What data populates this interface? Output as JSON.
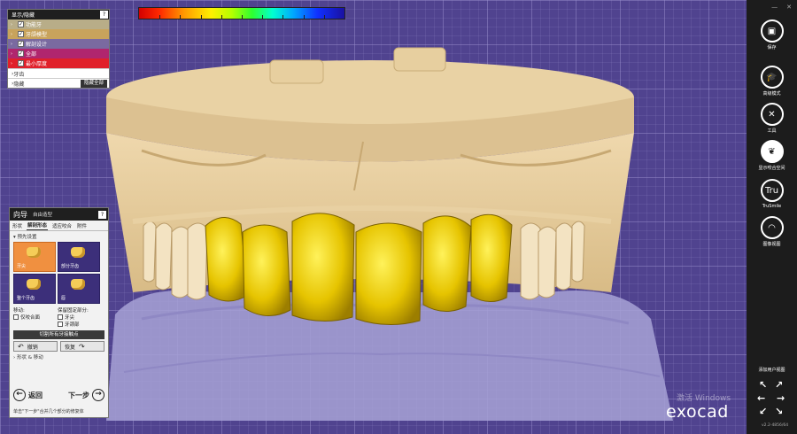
{
  "layers": {
    "header": "显示/隐藏",
    "help": "?",
    "items": [
      {
        "label": "功能牙",
        "color": "#b8ad88"
      },
      {
        "label": "牙颌模型",
        "color": "#c8a35c"
      },
      {
        "label": "解剖设计",
        "color": "#7a6aa0"
      },
      {
        "label": "全部",
        "color": "#b0266e"
      },
      {
        "label": "最小厚度",
        "color": "#e0202a"
      }
    ],
    "collapsed": [
      {
        "label": "牙齿"
      },
      {
        "label": "隐藏",
        "button": "隐藏全部"
      }
    ]
  },
  "wizard": {
    "title": "向导",
    "subtitle": "自由造型",
    "help": "?",
    "tabs": [
      "形状",
      "解剖形态",
      "适应咬合",
      "附件"
    ],
    "section": "预先设置",
    "tiles": [
      {
        "label": "牙尖",
        "active": true
      },
      {
        "label": "部分牙齿",
        "active": false
      },
      {
        "label": "整个牙齿",
        "active": false
      },
      {
        "label": "唇",
        "active": false
      }
    ],
    "move_label": "移动:",
    "move_options": [
      "仅咬合面"
    ],
    "protect_label": "保留固定部分:",
    "protect_options": [
      "牙尖",
      "牙颈部"
    ],
    "smooth_all": "切割所有牙接触点",
    "undo": "撤销",
    "redo": "恢复",
    "morph_section": "形状 & 移动",
    "back": "返回",
    "next": "下一步",
    "hint": "单击\"下一步\"合并几个部分的修复体"
  },
  "toolbar": {
    "tools": [
      {
        "label": "保存",
        "icon": "save-icon",
        "glyph": "▣"
      },
      {
        "label": "高级模式",
        "icon": "expert-icon",
        "glyph": "🎓"
      },
      {
        "label": "工具",
        "icon": "tools-icon",
        "glyph": "✕"
      },
      {
        "label": "显示咬合空间",
        "icon": "occlusion-icon",
        "glyph": "❦"
      },
      {
        "label": "TruSmile",
        "icon": "trusmile-icon",
        "glyph": "Tru"
      },
      {
        "label": "图像视图",
        "icon": "image-view-icon",
        "glyph": "◠"
      }
    ],
    "add_view": "添加用户视图",
    "version": "v2.2-4856/64"
  },
  "watermark": "激活 Windows",
  "logo": "exocad"
}
